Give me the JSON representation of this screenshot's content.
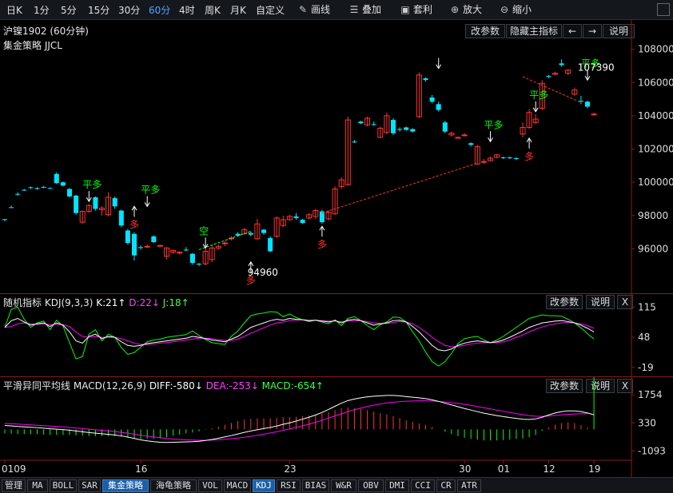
{
  "toolbar": {
    "periods": [
      "日K",
      "1分",
      "5分",
      "15分",
      "30分",
      "60分",
      "4时",
      "周K",
      "月K",
      "自定义"
    ],
    "active_period": "60分",
    "tools": [
      {
        "label": "画线",
        "icon": "pencil-icon"
      },
      {
        "label": "叠加",
        "icon": "stack-icon"
      },
      {
        "label": "套利",
        "icon": "bag-icon"
      },
      {
        "label": "放大",
        "icon": "zoom-in-icon"
      },
      {
        "label": "缩小",
        "icon": "zoom-out-icon"
      }
    ]
  },
  "main": {
    "symbol": "沪镍1902 (60分钟)",
    "strategy": "集金策略 JJCL",
    "buttons": {
      "params": "改参数",
      "hide": "隐藏主指标",
      "prev": "←",
      "next": "→",
      "help": "说明"
    },
    "y_labels": [
      "108000",
      "106000",
      "104000",
      "102000",
      "100000",
      "98000",
      "96000"
    ],
    "high_label": "107390",
    "low_label": "94960",
    "signals": {
      "pingduo": "平多",
      "duo": "多",
      "kong": "空"
    }
  },
  "kdj": {
    "name": "随机指标",
    "params": "KDJ(9,3,3)",
    "k": "K:21↑",
    "d": "D:22↓",
    "j": "J:18↑",
    "y_labels": [
      "115",
      "48",
      "-19"
    ],
    "buttons": {
      "params": "改参数",
      "help": "说明",
      "close": "X"
    }
  },
  "macd": {
    "name": "平滑异同平均线",
    "params": "MACD(12,26,9)",
    "diff": "DIFF:-580↓",
    "dea": "DEA:-253↓",
    "macd": "MACD:-654↑",
    "y_labels": [
      "1754",
      "330",
      "-1093"
    ],
    "buttons": {
      "params": "改参数",
      "help": "说明",
      "close": "X"
    }
  },
  "x_axis": [
    "0109",
    "16",
    "23",
    "30",
    "01",
    "12",
    "19"
  ],
  "bottom_tabs": [
    "管理",
    "MA",
    "BOLL",
    "SAR",
    "集金策略",
    "海龟策略",
    "VOL",
    "MACD",
    "KDJ",
    "RSI",
    "BIAS",
    "W&R",
    "OBV",
    "DMI",
    "CCI",
    "CR",
    "ATR"
  ],
  "active_tabs": [
    "集金策略",
    "KDJ"
  ],
  "colors": {
    "up": "#ff3232",
    "down": "#00e5ff",
    "diff": "#ffffff",
    "dea": "#ff00ff",
    "j": "#00ff00",
    "signal_green": "#00ff00",
    "signal_red": "#ff3232",
    "bg": "#000000"
  },
  "chart_data": {
    "type": "candlestick",
    "candles": [
      [
        97780,
        97800,
        97650,
        97750
      ],
      [
        98500,
        98600,
        98450,
        98480
      ],
      [
        99300,
        99400,
        99200,
        99250
      ],
      [
        99550,
        99600,
        99480,
        99500
      ],
      [
        99700,
        99750,
        99600,
        99650
      ],
      [
        99650,
        99700,
        99550,
        99600
      ],
      [
        99720,
        99780,
        99650,
        99700
      ],
      [
        99650,
        99700,
        99600,
        99620
      ],
      [
        100500,
        100600,
        99900,
        99950
      ],
      [
        100000,
        100050,
        99750,
        99800
      ],
      [
        99600,
        99650,
        99100,
        99150
      ],
      [
        99200,
        99250,
        98050,
        98150
      ],
      [
        97600,
        98300,
        97500,
        98250
      ],
      [
        98250,
        98700,
        98150,
        98600
      ],
      [
        99100,
        99150,
        98300,
        98400
      ],
      [
        98350,
        98550,
        98000,
        98450
      ],
      [
        98050,
        99400,
        97950,
        99100
      ],
      [
        99050,
        99150,
        98400,
        98550
      ],
      [
        98300,
        98350,
        97300,
        97400
      ],
      [
        97100,
        97200,
        96250,
        96350
      ],
      [
        96900,
        97000,
        95300,
        95600
      ],
      [
        96100,
        96200,
        95950,
        96050
      ],
      [
        96150,
        96250,
        96050,
        96150
      ],
      [
        96750,
        96800,
        96350,
        96400
      ],
      [
        96200,
        96250,
        96150,
        96200
      ],
      [
        95550,
        96100,
        95350,
        96050
      ],
      [
        95800,
        95950,
        95700,
        95900
      ],
      [
        95750,
        95850,
        95650,
        95800
      ],
      [
        95950,
        96100,
        95850,
        95900
      ],
      [
        95700,
        95750,
        95050,
        95150
      ],
      [
        95100,
        95150,
        94960,
        95050
      ],
      [
        95100,
        96050,
        95000,
        95850
      ],
      [
        95350,
        96250,
        95200,
        96050
      ],
      [
        96050,
        96250,
        95950,
        96150
      ],
      [
        96350,
        96450,
        96150,
        96350
      ],
      [
        96600,
        96750,
        96500,
        96650
      ],
      [
        96900,
        97000,
        96750,
        96800
      ],
      [
        96900,
        97250,
        96850,
        97150
      ],
      [
        96950,
        97050,
        96750,
        96850
      ],
      [
        96600,
        97800,
        96550,
        97500
      ],
      [
        97150,
        97200,
        96850,
        96950
      ],
      [
        96650,
        96750,
        95800,
        95850
      ],
      [
        96750,
        97950,
        96650,
        97850
      ],
      [
        97400,
        98000,
        97300,
        97750
      ],
      [
        97750,
        98050,
        97700,
        97950
      ],
      [
        97950,
        98150,
        97750,
        97850
      ],
      [
        97750,
        97800,
        97500,
        97550
      ],
      [
        97850,
        98150,
        97750,
        98050
      ],
      [
        97950,
        98400,
        97800,
        98300
      ],
      [
        98250,
        98350,
        97500,
        97600
      ],
      [
        97800,
        98300,
        97700,
        98200
      ],
      [
        98100,
        99750,
        98050,
        99600
      ],
      [
        99750,
        100300,
        99600,
        100150
      ],
      [
        99850,
        103950,
        99800,
        103750
      ],
      [
        102450,
        102550,
        102350,
        102400
      ],
      [
        103650,
        103700,
        103500,
        103550
      ],
      [
        103450,
        103950,
        103350,
        103850
      ],
      [
        103500,
        103650,
        103400,
        103450
      ],
      [
        102700,
        103350,
        102650,
        103250
      ],
      [
        103000,
        104200,
        102900,
        104000
      ],
      [
        103750,
        103850,
        102850,
        102950
      ],
      [
        103200,
        103300,
        103050,
        103150
      ],
      [
        103300,
        103350,
        103100,
        103150
      ],
      [
        103200,
        103250,
        103000,
        103050
      ],
      [
        103950,
        106600,
        103850,
        106450
      ],
      [
        106250,
        106300,
        106050,
        106150
      ],
      [
        105100,
        105250,
        104750,
        104850
      ],
      [
        104700,
        104850,
        104250,
        104350
      ],
      [
        103600,
        103700,
        102950,
        103050
      ],
      [
        102850,
        103050,
        102750,
        102950
      ],
      [
        102700,
        102750,
        102650,
        102700
      ],
      [
        102850,
        102950,
        102750,
        102850
      ],
      [
        102350,
        102400,
        102150,
        102250
      ],
      [
        101100,
        102250,
        101050,
        102150
      ],
      [
        101200,
        101400,
        101100,
        101250
      ],
      [
        101300,
        101550,
        101250,
        101450
      ],
      [
        101500,
        101700,
        101450,
        101650
      ],
      [
        101500,
        101550,
        101400,
        101450
      ],
      [
        101500,
        101550,
        101400,
        101450
      ],
      [
        101450,
        101500,
        101350,
        101400
      ],
      [
        102900,
        103600,
        102700,
        103300
      ],
      [
        103300,
        104400,
        103200,
        104200
      ],
      [
        103600,
        104100,
        103500,
        103800
      ],
      [
        104450,
        106150,
        104350,
        105950
      ],
      [
        106400,
        106450,
        106250,
        106350
      ],
      [
        106550,
        106650,
        106450,
        106550
      ],
      [
        107150,
        107390,
        106950,
        107050
      ],
      [
        106550,
        106800,
        106450,
        106750
      ],
      [
        105300,
        105700,
        105200,
        105550
      ],
      [
        104900,
        105200,
        104700,
        104850
      ],
      [
        104850,
        104900,
        104450,
        104550
      ],
      [
        104100,
        104200,
        104050,
        104100
      ]
    ],
    "ylim": [
      94000,
      108800
    ],
    "stop_line_red": [
      [
        49,
        98150
      ],
      [
        73,
        101150
      ]
    ],
    "stop_line_green": [
      [
        30,
        95950
      ],
      [
        38,
        97050
      ]
    ],
    "stop_line_red2": [
      [
        80,
        106350
      ],
      [
        89,
        104800
      ]
    ],
    "kdj": {
      "ylim": [
        -30,
        130
      ],
      "k": [
        70,
        85,
        90,
        82,
        75,
        78,
        80,
        72,
        80,
        75,
        60,
        40,
        35,
        50,
        55,
        45,
        50,
        48,
        38,
        30,
        28,
        30,
        34,
        36,
        38,
        40,
        42,
        44,
        46,
        50,
        48,
        45,
        42,
        40,
        38,
        44,
        50,
        60,
        70,
        75,
        80,
        85,
        88,
        86,
        90,
        88,
        87,
        85,
        86,
        84,
        82,
        85,
        80,
        86,
        88,
        85,
        80,
        75,
        78,
        80,
        85,
        86,
        82,
        72,
        60,
        45,
        30,
        20,
        18,
        22,
        30,
        35,
        38,
        40,
        38,
        36,
        38,
        42,
        48,
        55,
        62,
        70,
        75,
        80,
        82,
        84,
        85,
        83,
        80,
        75,
        68,
        60
      ],
      "d": [
        70,
        72,
        78,
        80,
        78,
        77,
        78,
        76,
        77,
        76,
        72,
        60,
        50,
        48,
        50,
        48,
        48,
        48,
        45,
        40,
        35,
        32,
        32,
        33,
        35,
        36,
        38,
        40,
        42,
        44,
        46,
        46,
        45,
        43,
        41,
        41,
        44,
        50,
        57,
        63,
        69,
        75,
        80,
        82,
        85,
        86,
        87,
        86,
        86,
        85,
        84,
        84,
        83,
        84,
        85,
        85,
        83,
        80,
        79,
        79,
        81,
        83,
        82,
        78,
        70,
        60,
        48,
        38,
        30,
        27,
        28,
        30,
        33,
        35,
        36,
        36,
        36,
        38,
        42,
        48,
        53,
        60,
        66,
        71,
        75,
        78,
        80,
        81,
        80,
        78,
        74,
        68
      ],
      "j": [
        70,
        110,
        115,
        88,
        70,
        80,
        84,
        65,
        86,
        73,
        36,
        0,
        5,
        55,
        65,
        40,
        55,
        48,
        25,
        10,
        14,
        26,
        38,
        42,
        44,
        48,
        50,
        52,
        54,
        62,
        52,
        43,
        36,
        34,
        32,
        50,
        62,
        80,
        96,
        100,
        102,
        105,
        104,
        94,
        100,
        92,
        87,
        83,
        86,
        82,
        78,
        87,
        74,
        90,
        94,
        85,
        74,
        65,
        76,
        82,
        93,
        92,
        82,
        60,
        40,
        15,
        -6,
        -16,
        -6,
        12,
        34,
        45,
        48,
        50,
        42,
        36,
        42,
        50,
        60,
        70,
        80,
        90,
        94,
        98,
        96,
        96,
        95,
        88,
        80,
        69,
        56,
        44
      ]
    },
    "macd": {
      "ylim": [
        -1400,
        2000
      ],
      "diff": [
        200,
        180,
        150,
        130,
        110,
        90,
        60,
        30,
        10,
        -10,
        -40,
        -80,
        -120,
        -160,
        -190,
        -220,
        -250,
        -280,
        -330,
        -390,
        -460,
        -530,
        -580,
        -620,
        -650,
        -660,
        -650,
        -640,
        -630,
        -620,
        -600,
        -560,
        -510,
        -450,
        -380,
        -310,
        -230,
        -150,
        -80,
        -20,
        40,
        100,
        170,
        260,
        330,
        420,
        520,
        620,
        730,
        860,
        1010,
        1170,
        1330,
        1460,
        1540,
        1600,
        1650,
        1680,
        1700,
        1720,
        1720,
        1700,
        1660,
        1630,
        1600,
        1560,
        1500,
        1420,
        1330,
        1240,
        1150,
        1060,
        980,
        900,
        820,
        760,
        700,
        650,
        600,
        560,
        520,
        500,
        530,
        620,
        730,
        830,
        900,
        940,
        940,
        900,
        830,
        740
      ],
      "dea": [
        300,
        290,
        270,
        250,
        230,
        210,
        190,
        170,
        150,
        130,
        100,
        70,
        40,
        10,
        -20,
        -50,
        -80,
        -110,
        -150,
        -190,
        -240,
        -290,
        -340,
        -380,
        -420,
        -460,
        -490,
        -510,
        -530,
        -540,
        -550,
        -550,
        -540,
        -520,
        -500,
        -470,
        -440,
        -400,
        -350,
        -300,
        -240,
        -180,
        -120,
        -50,
        20,
        100,
        180,
        270,
        360,
        460,
        570,
        680,
        790,
        900,
        1000,
        1080,
        1160,
        1230,
        1290,
        1340,
        1380,
        1410,
        1430,
        1440,
        1450,
        1450,
        1440,
        1420,
        1390,
        1360,
        1320,
        1270,
        1220,
        1160,
        1100,
        1040,
        980,
        920,
        860,
        800,
        750,
        700,
        670,
        660,
        680,
        710,
        740,
        760,
        780,
        790,
        790
      ]
    }
  }
}
